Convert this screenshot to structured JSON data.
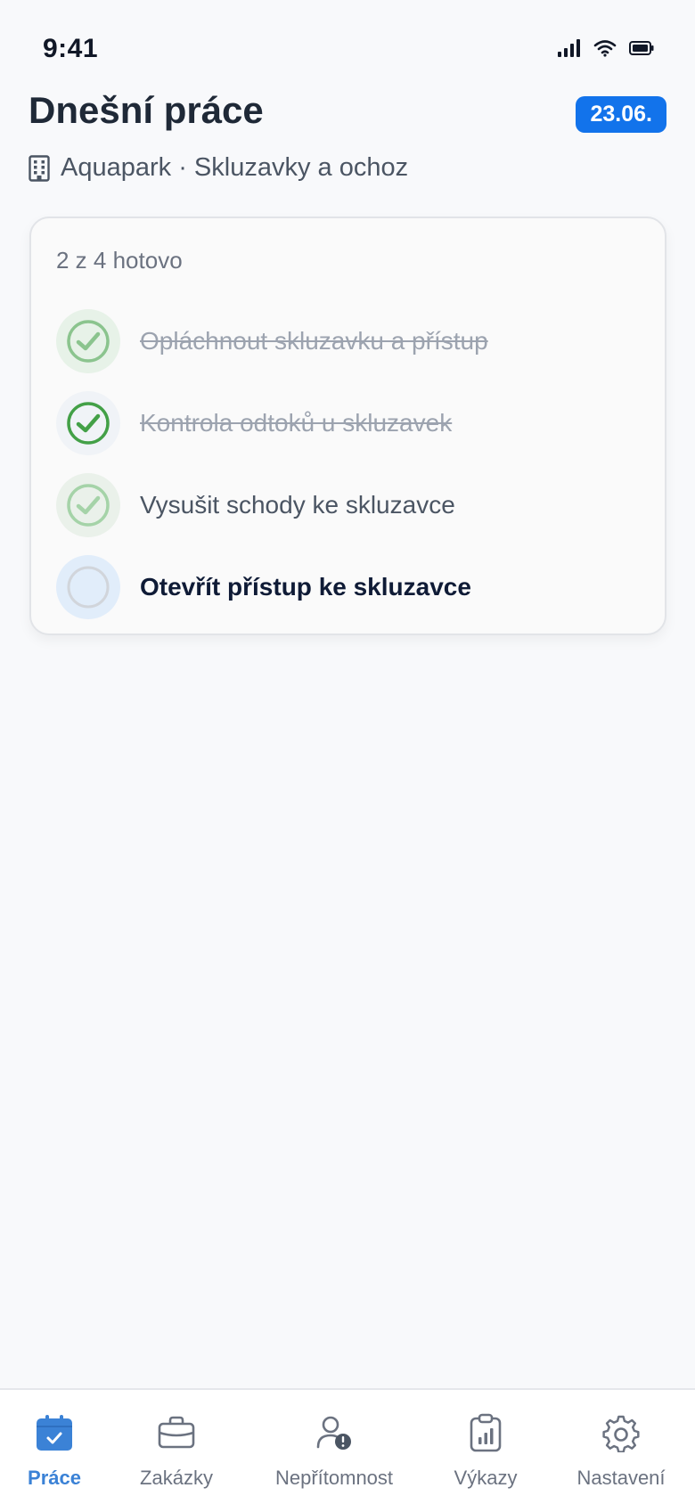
{
  "status_bar": {
    "time": "9:41"
  },
  "header": {
    "title": "Dnešní práce",
    "date_badge": "23.06.",
    "location": "Aquapark · Skluzavky a ochoz"
  },
  "tasks": {
    "progress": "2 z 4 hotovo",
    "items": [
      {
        "label": "Opláchnout skluzavku a přístup",
        "state": "done"
      },
      {
        "label": "Kontrola odtoků u skluzavek",
        "state": "done"
      },
      {
        "label": "Vysušit schody ke skluzavce",
        "state": "done"
      },
      {
        "label": "Otevřít přístup ke skluzavce",
        "state": "pending"
      }
    ]
  },
  "bottom_nav": {
    "items": [
      {
        "label": "Práce",
        "icon": "calendar-check-icon",
        "active": true
      },
      {
        "label": "Zakázky",
        "icon": "briefcase-icon",
        "active": false
      },
      {
        "label": "Nepřítomnost",
        "icon": "user-alert-icon",
        "active": false
      },
      {
        "label": "Výkazy",
        "icon": "clipboard-chart-icon",
        "active": false
      },
      {
        "label": "Nastavení",
        "icon": "gear-icon",
        "active": false
      }
    ]
  },
  "colors": {
    "accent": "#1273EB",
    "nav_active": "#3B82D6",
    "check_green": "#4CAF50",
    "background": "#F8F9FB"
  }
}
